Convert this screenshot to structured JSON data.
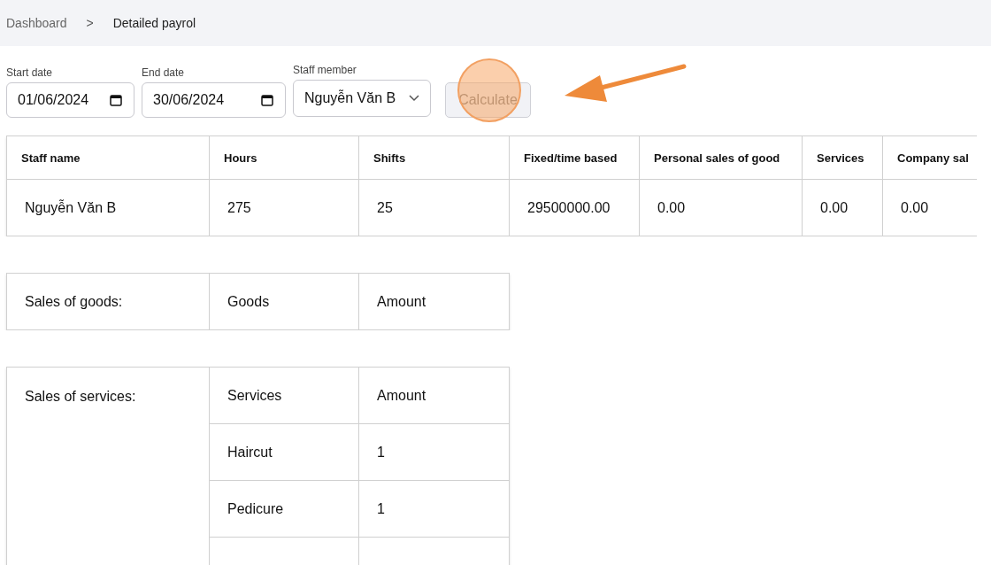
{
  "breadcrumb": {
    "items": [
      "Dashboard",
      "Detailed payrol"
    ],
    "separator": ">"
  },
  "filters": {
    "start_date": {
      "label": "Start date",
      "value": "01/06/2024"
    },
    "end_date": {
      "label": "End date",
      "value": "30/06/2024"
    },
    "staff_member": {
      "label": "Staff member",
      "value": "Nguyễn Văn B"
    },
    "calculate_button": {
      "label": "Calculate",
      "disabled": true
    }
  },
  "payroll_table": {
    "columns": [
      "Staff name",
      "Hours",
      "Shifts",
      "Fixed/time based",
      "Personal sales of good",
      "Services",
      "Company sal"
    ],
    "rows": [
      [
        "Nguyễn Văn B",
        "275",
        "25",
        "29500000.00",
        "0.00",
        "0.00",
        "0.00"
      ]
    ]
  },
  "goods_table": {
    "label": "Sales of goods:",
    "columns": [
      "Goods",
      "Amount"
    ]
  },
  "services_table": {
    "label": "Sales of services:",
    "columns": [
      "Services",
      "Amount"
    ],
    "rows": [
      [
        "Haircut",
        "1"
      ],
      [
        "Pedicure",
        "1"
      ]
    ]
  }
}
